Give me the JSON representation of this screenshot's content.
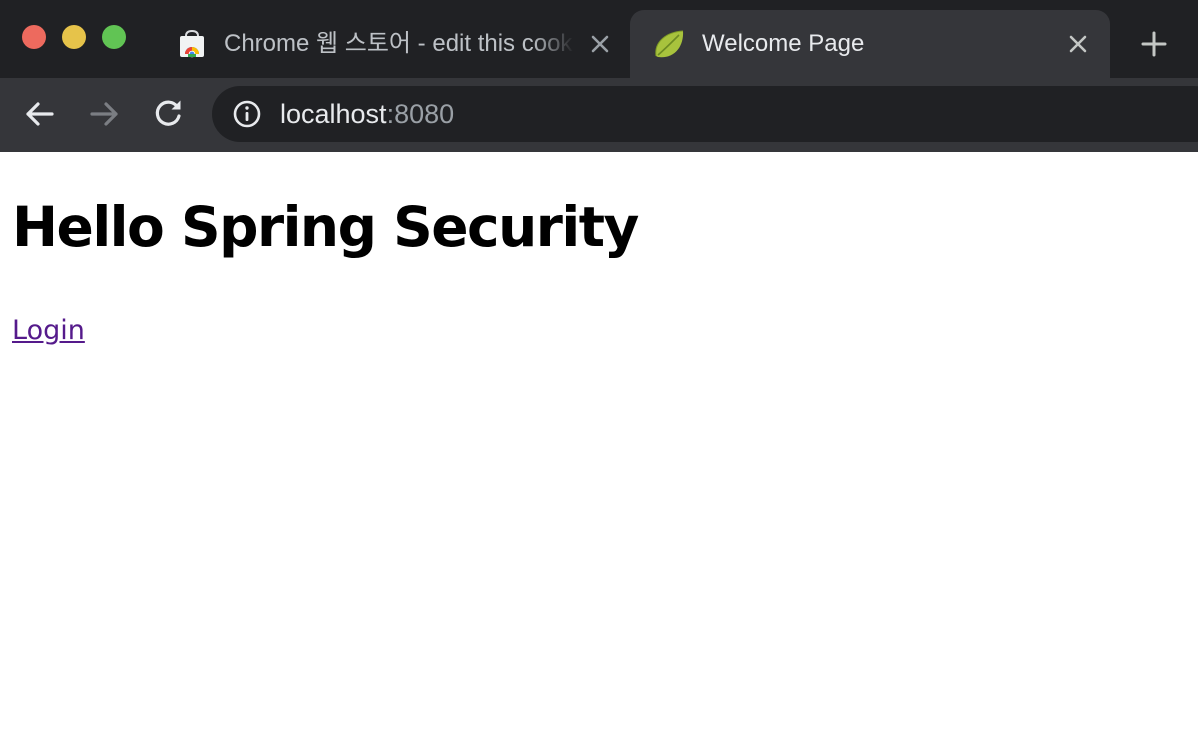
{
  "browser": {
    "tabs": [
      {
        "title": "Chrome 웹 스토어 - edit this cookie",
        "favicon": "chrome-web-store-icon",
        "active": false
      },
      {
        "title": "Welcome Page",
        "favicon": "spring-leaf-icon",
        "active": true
      }
    ],
    "address_bar": {
      "host": "localhost",
      "port": ":8080"
    },
    "icons": {
      "back": "arrow-left-icon",
      "forward": "arrow-right-icon",
      "reload": "reload-icon",
      "site_info": "info-icon",
      "new_tab": "plus-icon",
      "tab_close": "close-icon"
    },
    "colors": {
      "tab_strip": "#202124",
      "toolbar": "#35363a",
      "traffic_close": "#ed6a5e",
      "traffic_minimize": "#e6c34a",
      "traffic_maximize": "#61c454"
    }
  },
  "page": {
    "heading": "Hello Spring Security",
    "login_link": "Login",
    "colors": {
      "link": "#551a8b",
      "text": "#000000"
    }
  }
}
